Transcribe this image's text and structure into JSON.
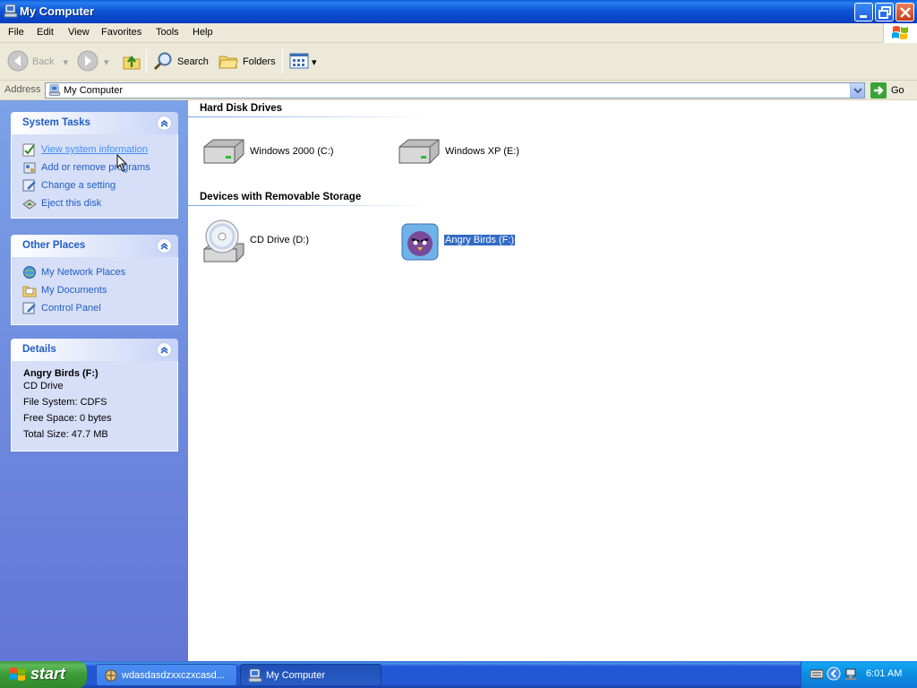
{
  "window": {
    "title": "My Computer"
  },
  "menu": {
    "items": [
      "File",
      "Edit",
      "View",
      "Favorites",
      "Tools",
      "Help"
    ]
  },
  "toolbar": {
    "back": "Back",
    "search": "Search",
    "folders": "Folders"
  },
  "address": {
    "label": "Address",
    "value": "My Computer",
    "go": "Go"
  },
  "system_tasks": {
    "title": "System Tasks",
    "items": [
      "View system information",
      "Add or remove programs",
      "Change a setting",
      "Eject this disk"
    ]
  },
  "other_places": {
    "title": "Other Places",
    "items": [
      "My Network Places",
      "My Documents",
      "Control Panel"
    ]
  },
  "details": {
    "title": "Details",
    "name": "Angry Birds (F:)",
    "type": "CD Drive",
    "file_system": "File System: CDFS",
    "free_space": "Free Space: 0 bytes",
    "total_size": "Total Size: 47.7 MB"
  },
  "groups": {
    "hard_disks": {
      "title": "Hard Disk Drives",
      "items": [
        "Windows 2000 (C:)",
        "Windows XP (E:)"
      ]
    },
    "removable": {
      "title": "Devices with Removable Storage",
      "items": [
        "CD Drive (D:)",
        "Angry Birds (F:)"
      ]
    }
  },
  "taskbar": {
    "start": "start",
    "tasks": [
      "wdasdasdzxxczxcasd...",
      "My Computer"
    ],
    "clock": "6:01 AM"
  },
  "colors": {
    "titlebar": "#0c56d6",
    "task_link": "#215dc6",
    "selection": "#316ac5",
    "start_green": "#3b9c37"
  },
  "icons": {
    "titlebar": "my-computer-icon",
    "hard_disk": "hard-disk-icon",
    "cd_drive": "cd-drive-icon",
    "angry_birds": "angry-birds-drive-icon"
  }
}
